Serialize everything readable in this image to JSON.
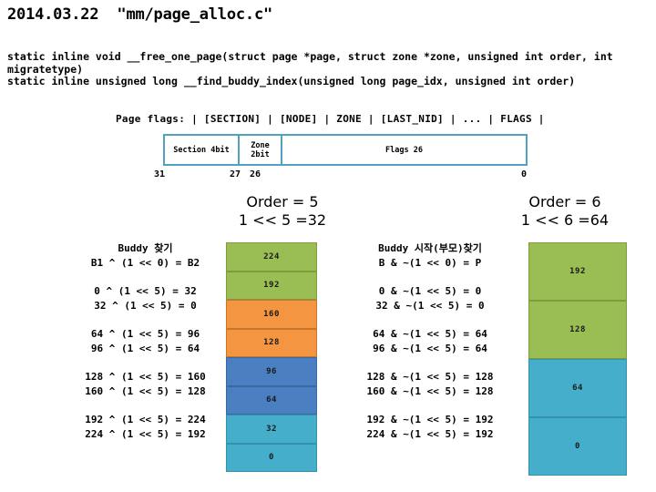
{
  "title": "2014.03.22  \"mm/page_alloc.c\"",
  "code": "static inline void __free_one_page(struct page *page, struct zone *zone, unsigned int order, int migratetype)\nstatic inline unsigned long __find_buddy_index(unsigned long page_idx, unsigned int order)",
  "page_flags": {
    "line": "Page flags: | [SECTION] | [NODE] | ZONE | [LAST_NID] | ... | FLAGS |",
    "border_color": "#4FA3BE",
    "cells": [
      {
        "label": "Section 4bit"
      },
      {
        "label": "Zone\n2bit"
      },
      {
        "label": "Flags 26"
      }
    ],
    "bit_labels": {
      "left": "31",
      "mid_high": "27",
      "mid_low": "26",
      "right": "0"
    }
  },
  "left_panel": {
    "order_heading": "Order = 5\n1 << 5 =32",
    "formula_title": "Buddy 찾기",
    "formula_subtitle": "B1 ^ (1 << 0) = B2",
    "groups": [
      [
        "0 ^ (1 << 5) = 32",
        "32 ^ (1 << 5) = 0"
      ],
      [
        "64 ^ (1 << 5) = 96",
        "96 ^ (1 << 5) = 64"
      ],
      [
        "128 ^ (1 << 5) = 160",
        "160 ^ (1 << 5) = 128"
      ],
      [
        "192 ^ (1 << 5) = 224",
        "224 ^ (1 << 5) = 192"
      ]
    ],
    "blocks": [
      {
        "label": "224",
        "fill": "#9BBE54",
        "border": "#7E9B3F"
      },
      {
        "label": "192",
        "fill": "#9BBE54",
        "border": "#7E9B3F"
      },
      {
        "label": "160",
        "fill": "#F49541",
        "border": "#C8752C"
      },
      {
        "label": "128",
        "fill": "#F49541",
        "border": "#C8752C"
      },
      {
        "label": "96",
        "fill": "#4A7FC1",
        "border": "#3A68A0"
      },
      {
        "label": "64",
        "fill": "#4A7FC1",
        "border": "#3A68A0"
      },
      {
        "label": "32",
        "fill": "#45AFCB",
        "border": "#3691AA"
      },
      {
        "label": "0",
        "fill": "#45AFCB",
        "border": "#3691AA"
      }
    ]
  },
  "right_panel": {
    "order_heading": "Order = 6\n1 << 6 =64",
    "formula_title": "Buddy 시작(부모)찾기",
    "formula_subtitle": "B & ~(1 << 0) = P",
    "groups": [
      [
        "0 & ~(1 << 5) = 0",
        "32 & ~(1 << 5) = 0"
      ],
      [
        "64 & ~(1 << 5) = 64",
        "96 & ~(1 << 5) = 64"
      ],
      [
        "128 & ~(1 << 5) = 128",
        "160 & ~(1 << 5) = 128"
      ],
      [
        "192 & ~(1 << 5) = 192",
        "224 & ~(1 << 5) = 192"
      ]
    ],
    "blocks": [
      {
        "label": "192",
        "fill": "#9BBE54",
        "border": "#7E9B3F"
      },
      {
        "label": "128",
        "fill": "#9BBE54",
        "border": "#7E9B3F"
      },
      {
        "label": "64",
        "fill": "#45AFCB",
        "border": "#3691AA"
      },
      {
        "label": "0",
        "fill": "#45AFCB",
        "border": "#3691AA"
      }
    ]
  }
}
